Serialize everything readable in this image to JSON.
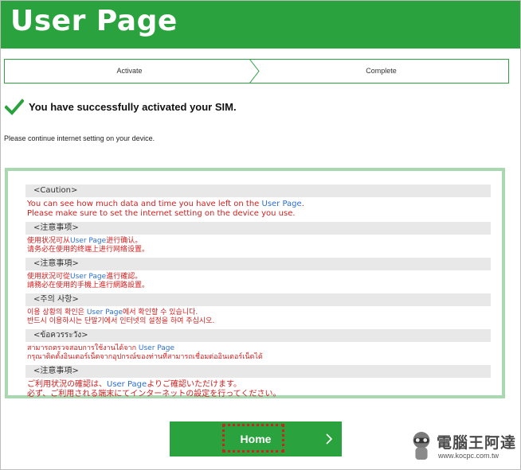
{
  "header": {
    "title": "User Page",
    "color": "#2aa33f"
  },
  "steps": [
    {
      "label": "Activate"
    },
    {
      "label": "Complete"
    }
  ],
  "success": {
    "icon": "checkmark-icon",
    "message": "You have successfully activated your SIM."
  },
  "instruction": "Please continue internet setting on your device.",
  "notices": [
    {
      "heading": "<Caution>",
      "lines": [
        [
          "You can see how much data and time you have left on the ",
          "User Page",
          "."
        ],
        [
          "Please make sure to set the internet setting on the device you use.",
          "",
          ""
        ]
      ]
    },
    {
      "heading": "<注意事项>",
      "lines": [
        [
          "使用状况可从",
          "User Page",
          "进行确认。"
        ],
        [
          "请务必在使用的终端上进行网络设置。",
          "",
          ""
        ]
      ]
    },
    {
      "heading": "<注意事項>",
      "lines": [
        [
          "使用狀況可從",
          "User Page",
          "進行確認。"
        ],
        [
          "請務必在使用的手機上進行網路設置。",
          "",
          ""
        ]
      ]
    },
    {
      "heading": "<주의 사항>",
      "lines": [
        [
          "이용 상황의 확인은 ",
          "User Page",
          "에서 확인할 수 있습니다."
        ],
        [
          "반드시 이용하시는 단말기에서 인터넷의 설정을 하여 주십시오.",
          "",
          ""
        ]
      ]
    },
    {
      "heading": "<ข้อควรระวัง>",
      "lines": [
        [
          "สามารถตรวจสอบการใช้งานได้จาก ",
          "User Page",
          ""
        ],
        [
          "กรุณาติดตั้งอินเตอร์เน็ตจากอุปกรณ์ของท่านที่สามารถเชื่อมต่ออินเตอร์เน็ตได้",
          "",
          ""
        ]
      ]
    },
    {
      "heading": "<注意事項>",
      "lines": [
        [
          "ご利用状況の確認は、",
          "User Page",
          "よりご確認いただけます。"
        ],
        [
          "必ず、ご利用される端末にてインターネットの設定を行ってください。",
          "",
          ""
        ]
      ]
    }
  ],
  "home_button": {
    "label": "Home",
    "icon": "chevron-right-icon"
  },
  "watermark": {
    "title": "電腦王阿達",
    "url": "www.kocpc.com.tw"
  },
  "colors": {
    "notice_text": "#d21e1e",
    "link": "#2b6fd6",
    "border_light": "#a9d8b0"
  }
}
